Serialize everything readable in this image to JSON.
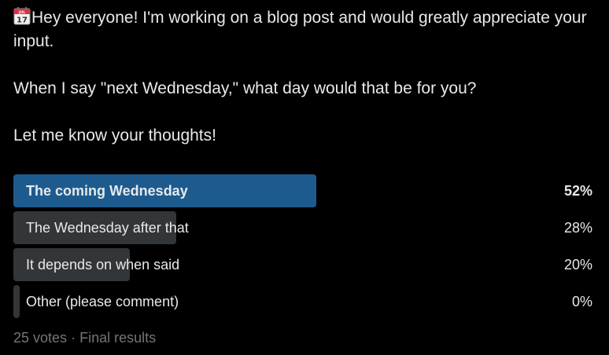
{
  "tweet": {
    "emoji_icon": "calendar-icon",
    "calendar_month": "JUL",
    "calendar_day": "17",
    "line1": "Hey everyone! I'm working on a blog post and would greatly appreciate your input.",
    "line2": "When I say \"next Wednesday,\" what day would that be for you?",
    "line3": "Let me know your thoughts!"
  },
  "poll": {
    "options": [
      {
        "label": "The coming Wednesday",
        "percent": 52,
        "percent_text": "52%",
        "winner": true
      },
      {
        "label": "The Wednesday after that",
        "percent": 28,
        "percent_text": "28%",
        "winner": false
      },
      {
        "label": "It depends on when said",
        "percent": 20,
        "percent_text": "20%",
        "winner": false
      },
      {
        "label": "Other (please comment)",
        "percent": 0,
        "percent_text": "0%",
        "winner": false
      }
    ],
    "votes": "25 votes",
    "separator": "·",
    "status": "Final results"
  },
  "colors": {
    "background": "#000000",
    "text": "#e7e9ea",
    "muted": "#71767b",
    "winner_bar": "#1d5b8f",
    "bar": "#333639"
  }
}
